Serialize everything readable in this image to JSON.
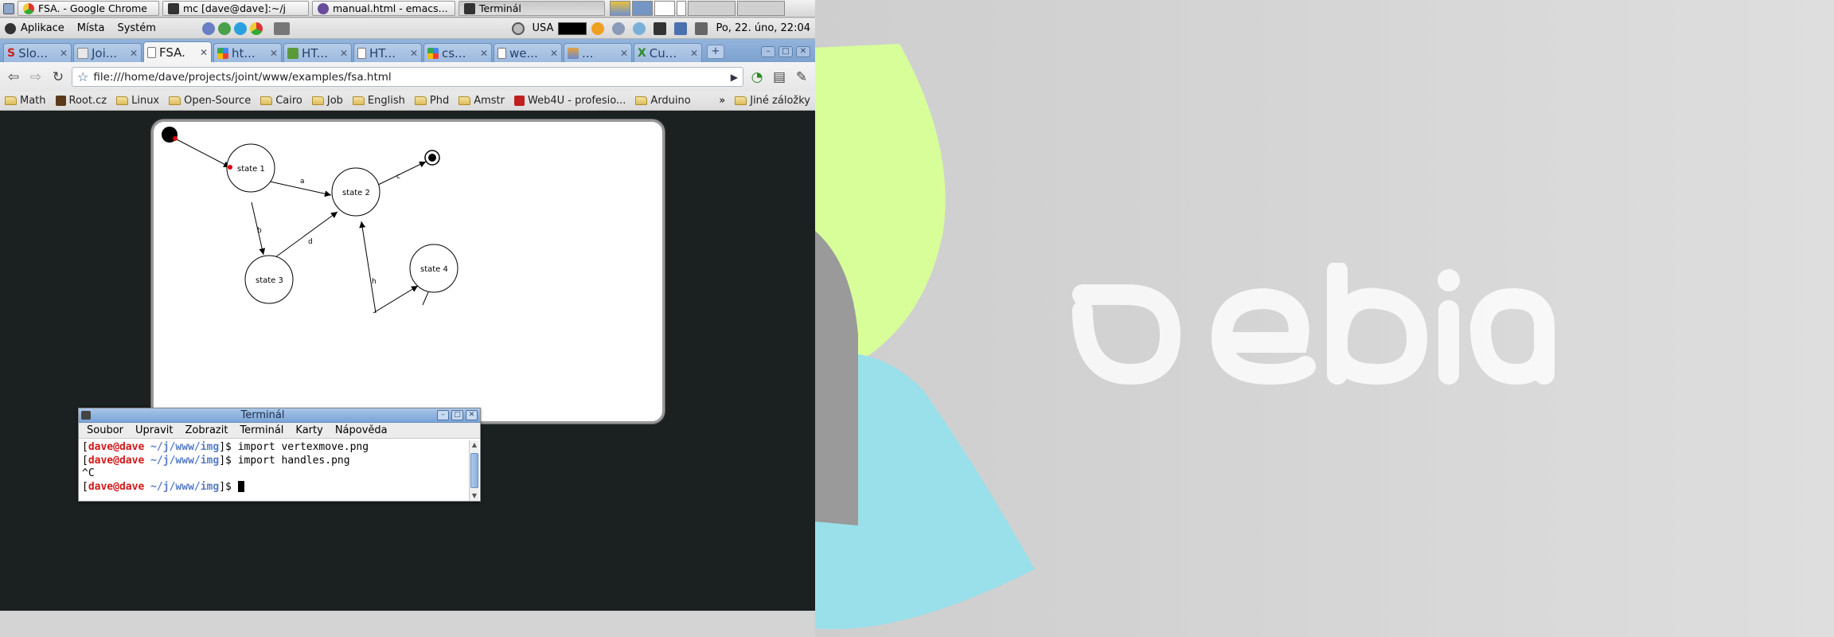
{
  "taskbar": {
    "tasks": [
      {
        "label": "FSA. - Google Chrome",
        "icon": "chrome-icon"
      },
      {
        "label": "mc [dave@dave]:~/j",
        "icon": "terminal-icon"
      },
      {
        "label": "manual.html - emacs...",
        "icon": "emacs-icon"
      },
      {
        "label": "Terminál",
        "icon": "terminal-icon",
        "active": true
      }
    ]
  },
  "menubar": {
    "items": [
      "Aplikace",
      "Místa",
      "Systém"
    ],
    "keyboard_layout": "USA",
    "clock": "Po, 22. úno, 22:04"
  },
  "browser": {
    "tabs": [
      {
        "label": "Slo...",
        "icon": "s-icon"
      },
      {
        "label": "Joi...",
        "icon": "page-icon"
      },
      {
        "label": "FSA.",
        "icon": "document-icon",
        "active": true
      },
      {
        "label": "ht...",
        "icon": "google-icon"
      },
      {
        "label": "HT...",
        "icon": "w3-icon"
      },
      {
        "label": "HT...",
        "icon": "document-icon"
      },
      {
        "label": "cs...",
        "icon": "google-icon"
      },
      {
        "label": "we...",
        "icon": "document-icon"
      },
      {
        "label": "...",
        "icon": "image-icon"
      },
      {
        "label": "Cu...",
        "icon": "x-icon"
      }
    ],
    "url": "file:///home/dave/projects/joint/www/examples/fsa.html",
    "bookmarks": [
      "Math",
      "Root.cz",
      "Linux",
      "Open-Source",
      "Cairo",
      "Job",
      "English",
      "Phd",
      "Amstr",
      "Web4U - profesio...",
      "Arduino"
    ],
    "bookmarks_overflow": "»",
    "other_bookmarks": "Jiné záložky"
  },
  "fsa": {
    "states": [
      "state 1",
      "state 2",
      "state 3",
      "state 4"
    ],
    "edge_labels": [
      "a",
      "b",
      "c",
      "d",
      "h"
    ]
  },
  "terminal": {
    "title": "Terminál",
    "menu": [
      "Soubor",
      "Upravit",
      "Zobrazit",
      "Terminál",
      "Karty",
      "Nápověda"
    ],
    "lines": [
      {
        "user": "dave@dave",
        "path": "~/j/www/img",
        "command": "import vertexmove.png"
      },
      {
        "user": "dave@dave",
        "path": "~/j/www/img",
        "command": "import handles.png"
      },
      {
        "text": "^C"
      },
      {
        "user": "dave@dave",
        "path": "~/j/www/img",
        "command": ""
      }
    ]
  },
  "colors": {
    "wallpaper_green": "#d8fe9a",
    "wallpaper_cyan": "#9ae0ea",
    "tab_strip_blue": "#8aaddb",
    "terminal_user_red": "#d01818",
    "terminal_path_blue": "#5a7cc8",
    "page_background": "#1b2020"
  }
}
